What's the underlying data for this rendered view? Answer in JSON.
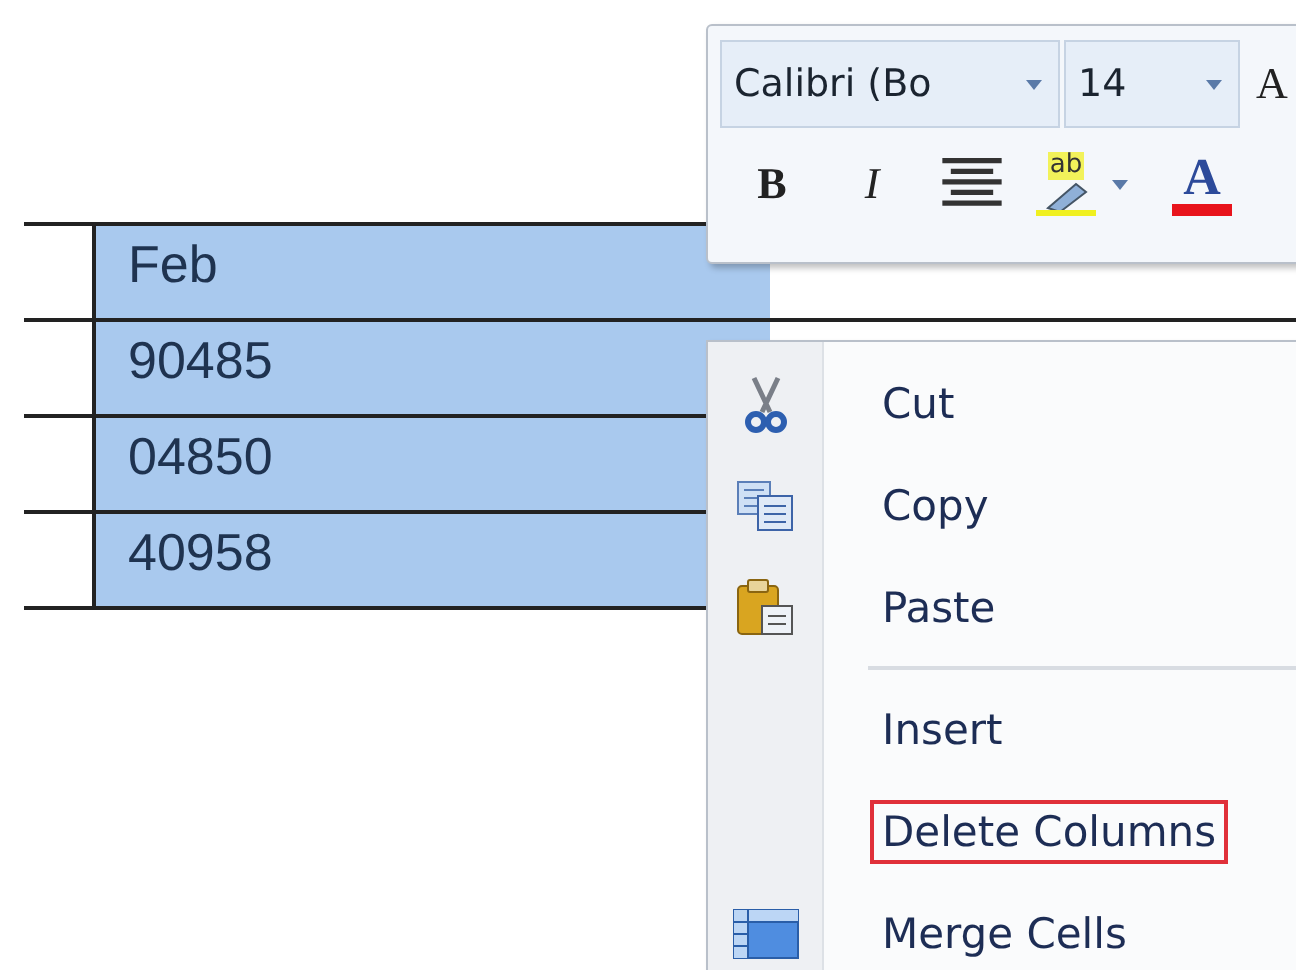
{
  "table": {
    "rows": [
      {
        "cells": [
          {
            "text": "Feb",
            "selected": true
          }
        ]
      },
      {
        "cells": [
          {
            "text": "90485",
            "selected": true
          }
        ]
      },
      {
        "cells": [
          {
            "text": "04850",
            "selected": true
          }
        ]
      },
      {
        "cells": [
          {
            "text": "40958",
            "selected": true
          }
        ]
      }
    ]
  },
  "mini_toolbar": {
    "font": "Calibri (Bo",
    "size": "14",
    "grow_font": "A",
    "bold": "B",
    "italic": "I",
    "highlight": "ab",
    "font_color": "A"
  },
  "context_menu": {
    "items": [
      {
        "kind": "item",
        "label": "Cut",
        "highlighted": false
      },
      {
        "kind": "item",
        "label": "Copy",
        "highlighted": false
      },
      {
        "kind": "item",
        "label": "Paste",
        "highlighted": false
      },
      {
        "kind": "separator"
      },
      {
        "kind": "item",
        "label": "Insert",
        "highlighted": false
      },
      {
        "kind": "item",
        "label": "Delete Columns",
        "highlighted": true
      },
      {
        "kind": "item",
        "label": "Merge Cells",
        "highlighted": false
      }
    ]
  }
}
